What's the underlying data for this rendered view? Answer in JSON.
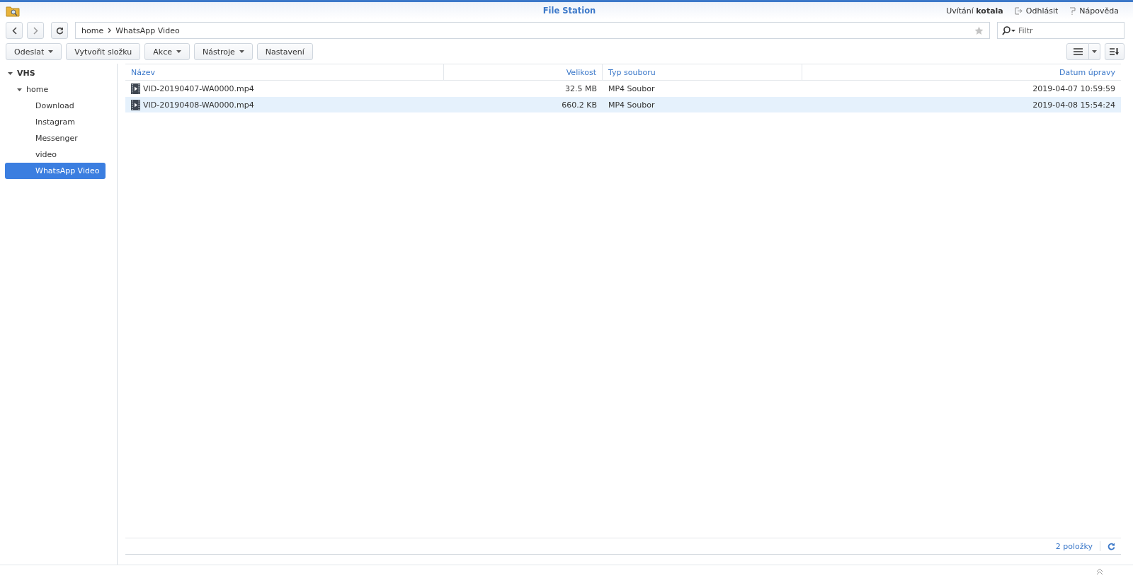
{
  "window": {
    "title": "File Station"
  },
  "user": {
    "greeting": "Uvítání",
    "name": "kotala"
  },
  "header_links": [
    {
      "label": "Odhlásit",
      "kind": "logout"
    },
    {
      "label": "Nápověda",
      "kind": "help"
    }
  ],
  "path": {
    "segments": [
      "home",
      "WhatsApp Video"
    ]
  },
  "filter": {
    "placeholder": "Filtr"
  },
  "toolbar": [
    {
      "label": "Odeslat",
      "dropdown": true
    },
    {
      "label": "Vytvořit složku",
      "dropdown": false
    },
    {
      "label": "Akce",
      "dropdown": true
    },
    {
      "label": "Nástroje",
      "dropdown": true
    },
    {
      "label": "Nastavení",
      "dropdown": false
    }
  ],
  "tree": [
    {
      "label": "VHS",
      "expanded": true,
      "selected": false,
      "children": [
        {
          "label": "home",
          "expanded": true,
          "selected": false,
          "children": [
            {
              "label": "Download",
              "selected": false
            },
            {
              "label": "Instagram",
              "selected": false
            },
            {
              "label": "Messenger",
              "selected": false
            },
            {
              "label": "video",
              "selected": false
            },
            {
              "label": "WhatsApp Video",
              "selected": true
            }
          ]
        }
      ]
    }
  ],
  "table": {
    "columns": [
      "Název",
      "Velikost",
      "Typ souboru",
      "Datum úpravy"
    ],
    "rows": [
      {
        "name": "VID-20190407-WA0000.mp4",
        "size": "32.5 MB",
        "type": "MP4 Soubor",
        "modified": "2019-04-07 10:59:59",
        "selected": false
      },
      {
        "name": "VID-20190408-WA0000.mp4",
        "size": "660.2 KB",
        "type": "MP4 Soubor",
        "modified": "2019-04-08 15:54:24",
        "selected": true
      }
    ]
  },
  "status_bar": {
    "count": "2 položky"
  }
}
